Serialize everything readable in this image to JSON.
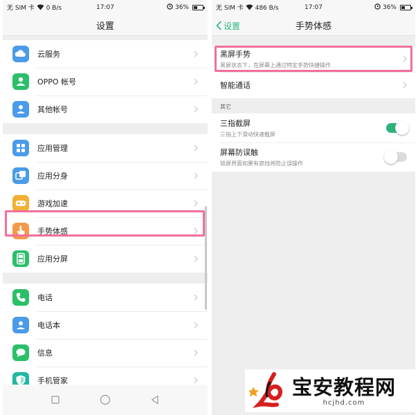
{
  "colors": {
    "accent": "#2ab57d",
    "highlight": "#f36e9b"
  },
  "left": {
    "status": {
      "carrier": "无 SIM 卡",
      "speed": "0 B/s",
      "time": "17:07",
      "battery": "36%"
    },
    "title": "设置",
    "groups": [
      [
        {
          "label": "云服务",
          "icon": "cloud-icon",
          "color": "#4a9be8"
        },
        {
          "label": "OPPO 帐号",
          "icon": "user-icon",
          "color": "#2bbf6a"
        },
        {
          "label": "其他帐号",
          "icon": "contact-icon",
          "color": "#4a9be8"
        }
      ],
      [
        {
          "label": "应用管理",
          "icon": "grid-icon",
          "color": "#4a9be8"
        },
        {
          "label": "应用分身",
          "icon": "clone-icon",
          "color": "#4a9be8"
        },
        {
          "label": "游戏加速",
          "icon": "gamepad-icon",
          "color": "#f2b035"
        },
        {
          "label": "手势体感",
          "icon": "hand-icon",
          "color": "#f39a4a"
        },
        {
          "label": "应用分屏",
          "icon": "split-screen-icon",
          "color": "#2bbf6a"
        }
      ],
      [
        {
          "label": "电话",
          "icon": "phone-icon",
          "color": "#2bbf6a"
        },
        {
          "label": "电话本",
          "icon": "contacts-book-icon",
          "color": "#4a9be8"
        },
        {
          "label": "信息",
          "icon": "message-icon",
          "color": "#2bbf6a"
        },
        {
          "label": "手机管家",
          "icon": "shield-icon",
          "color": "#22b7a0"
        }
      ]
    ]
  },
  "right": {
    "status": {
      "carrier": "无 SIM 卡",
      "speed": "486 B/s",
      "time": "17:07",
      "battery": "36%"
    },
    "back_label": "设置",
    "title": "手势体感",
    "items_top": [
      {
        "title": "黑屏手势",
        "subtitle": "黑屏状态下，在屏幕上通过特定手势快捷操作"
      },
      {
        "title": "智能通话",
        "subtitle": ""
      }
    ],
    "section_label": "其它",
    "toggles": [
      {
        "title": "三指截屏",
        "subtitle": "三指上下滑动快速截屏",
        "on": true
      },
      {
        "title": "屏幕防误触",
        "subtitle": "锁屏界面如果有遮挡将防止误操作",
        "on": false
      }
    ]
  },
  "watermark": {
    "title": "宝安教程网",
    "url": "hcjhd.com"
  }
}
